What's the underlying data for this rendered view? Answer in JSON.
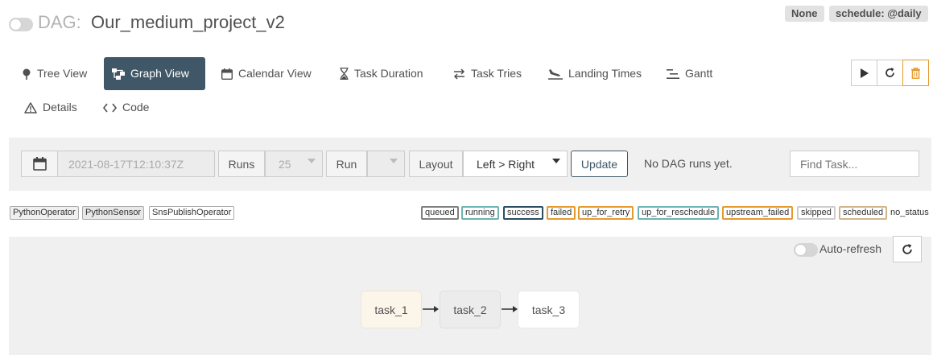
{
  "header": {
    "dag_prefix": "DAG:",
    "dag_name": "Our_medium_project_v2",
    "badge_none": "None",
    "badge_schedule": "schedule: @daily"
  },
  "nav": {
    "tree_view": "Tree View",
    "graph_view": "Graph View",
    "calendar_view": "Calendar View",
    "task_duration": "Task Duration",
    "task_tries": "Task Tries",
    "landing_times": "Landing Times",
    "gantt": "Gantt",
    "details": "Details",
    "code": "Code",
    "active": "graph_view"
  },
  "controls": {
    "datetime_value": "2021-08-17T12:10:37Z",
    "runs_label": "Runs",
    "runs_value": "25",
    "run_label": "Run",
    "layout_label": "Layout",
    "layout_value": "Left > Right",
    "update_button": "Update",
    "status_text": "No DAG runs yet.",
    "find_task_placeholder": "Find Task..."
  },
  "operator_legend": [
    "PythonOperator",
    "PythonSensor",
    "SnsPublishOperator"
  ],
  "state_legend": [
    "queued",
    "running",
    "success",
    "failed",
    "up_for_retry",
    "up_for_reschedule",
    "upstream_failed",
    "skipped",
    "scheduled",
    "no_status"
  ],
  "state_colors": {
    "queued": "#808080",
    "running": "#6db3b3",
    "success": "#2b4e63",
    "failed": "#e69a2e",
    "up_for_retry": "#e69a2e",
    "up_for_reschedule": "#6db3b3",
    "upstream_failed": "#e69a2e",
    "skipped": "#cccccc",
    "scheduled": "#d2b48c"
  },
  "graph": {
    "auto_refresh_label": "Auto-refresh",
    "tasks": [
      "task_1",
      "task_2",
      "task_3"
    ]
  }
}
